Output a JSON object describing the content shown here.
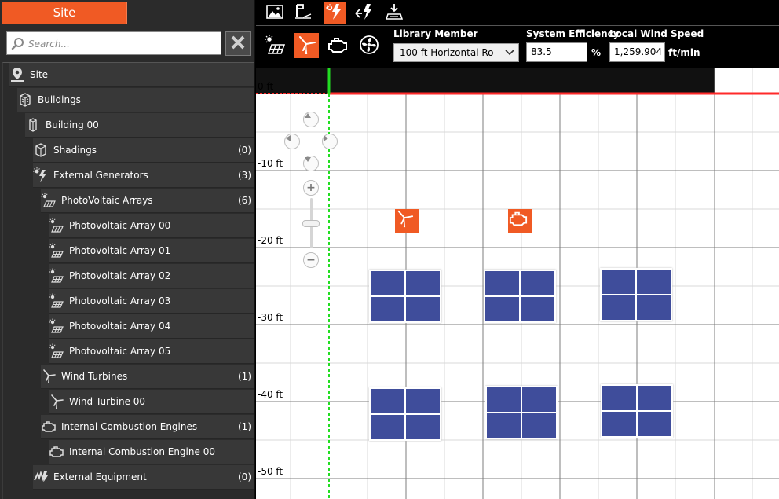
{
  "site_tab": {
    "label": "Site"
  },
  "search": {
    "placeholder": "Search...",
    "value": ""
  },
  "tree": [
    {
      "name": "tree-item-site",
      "label": "Site",
      "count": "",
      "icon": "map-pin-icon"
    },
    {
      "name": "tree-item-buildings",
      "label": "Buildings",
      "count": "",
      "icon": "building-icon"
    },
    {
      "name": "tree-item-building-00",
      "label": "Building 00",
      "count": "",
      "icon": "building-icon"
    },
    {
      "name": "tree-item-shadings",
      "label": "Shadings",
      "count": "(0)",
      "icon": "shading-icon"
    },
    {
      "name": "tree-item-external-generators",
      "label": "External Generators",
      "count": "(3)",
      "icon": "generators-icon"
    },
    {
      "name": "tree-item-photovoltaic-arrays",
      "label": "PhotoVoltaic Arrays",
      "count": "(6)",
      "icon": "solar-panel-icon"
    },
    {
      "name": "tree-item-pv-array-00",
      "label": "Photovoltaic Array 00",
      "count": "",
      "icon": "solar-panel-icon"
    },
    {
      "name": "tree-item-pv-array-01",
      "label": "Photovoltaic Array 01",
      "count": "",
      "icon": "solar-panel-icon"
    },
    {
      "name": "tree-item-pv-array-02",
      "label": "Photovoltaic Array 02",
      "count": "",
      "icon": "solar-panel-icon"
    },
    {
      "name": "tree-item-pv-array-03",
      "label": "Photovoltaic Array 03",
      "count": "",
      "icon": "solar-panel-icon"
    },
    {
      "name": "tree-item-pv-array-04",
      "label": "Photovoltaic Array 04",
      "count": "",
      "icon": "solar-panel-icon"
    },
    {
      "name": "tree-item-pv-array-05",
      "label": "Photovoltaic Array 05",
      "count": "",
      "icon": "solar-panel-icon"
    },
    {
      "name": "tree-item-wind-turbines",
      "label": "Wind Turbines",
      "count": "(1)",
      "icon": "wind-turbine-icon"
    },
    {
      "name": "tree-item-wind-turbine-00",
      "label": "Wind Turbine 00",
      "count": "",
      "icon": "wind-turbine-icon"
    },
    {
      "name": "tree-item-ic-engines",
      "label": "Internal Combustion Engines",
      "count": "(1)",
      "icon": "engine-icon"
    },
    {
      "name": "tree-item-ic-engine-00",
      "label": "Internal Combustion Engine 00",
      "count": "",
      "icon": "engine-icon"
    },
    {
      "name": "tree-item-external-equipment",
      "label": "External Equipment",
      "count": "(0)",
      "icon": "equipment-icon"
    }
  ],
  "toolbar": [
    {
      "name": "landscape-tool-button",
      "icon": "landscape-icon",
      "active": false
    },
    {
      "name": "survey-tool-button",
      "icon": "survey-icon",
      "active": false
    },
    {
      "name": "generators-tool-button",
      "icon": "generators-icon",
      "active": true
    },
    {
      "name": "equipment-tool-button",
      "icon": "equipment-icon",
      "active": false
    },
    {
      "name": "site-tool-button",
      "icon": "site-icon",
      "active": false
    }
  ],
  "generator_types": [
    {
      "name": "solar-panel-type-button",
      "icon": "solar-panel-icon",
      "active": false
    },
    {
      "name": "wind-turbine-type-button",
      "icon": "wind-turbine-icon",
      "active": true
    },
    {
      "name": "engine-type-button",
      "icon": "engine-icon",
      "active": false
    },
    {
      "name": "fan-type-button",
      "icon": "fan-icon",
      "active": false
    }
  ],
  "properties": {
    "library_member_label": "Library Member",
    "library_member_value": "100 ft Horizontal Ro",
    "system_efficiency_label": "System Efficiency",
    "system_efficiency_value": "83.5",
    "system_efficiency_unit": "%",
    "wind_speed_label": "Local Wind Speed",
    "wind_speed_value": "1,259.904",
    "wind_speed_unit": "ft/min"
  },
  "canvas": {
    "depth_labels": [
      "0 ft",
      "-10 ft",
      "-20 ft",
      "-30 ft",
      "-40 ft",
      "-50 ft"
    ],
    "zoom_in_label": "+",
    "zoom_out_label": "−",
    "pv_array_count": 6,
    "wind_turbine_count": 1,
    "engine_count": 1
  },
  "colors": {
    "accent": "#f05a24",
    "panel_blue": "#3f4d9b",
    "ground_line": "#ff2a2a",
    "origin_line": "#22dd22"
  }
}
